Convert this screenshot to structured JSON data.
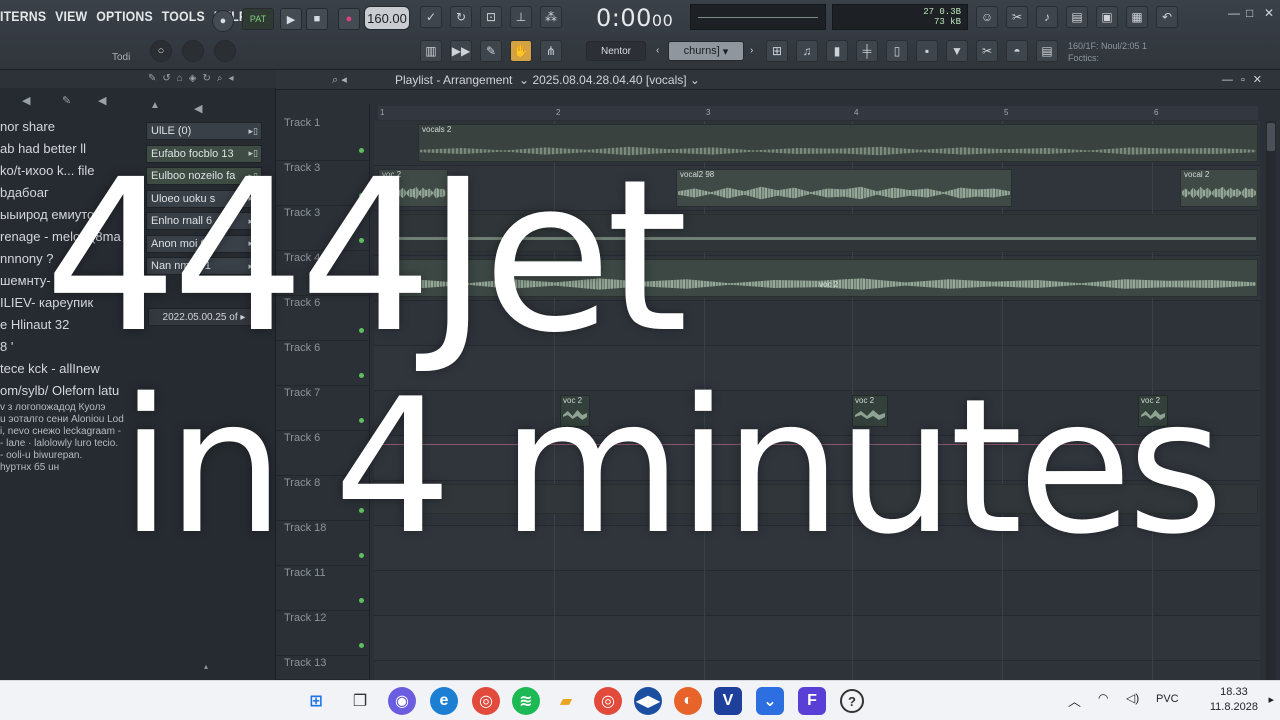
{
  "menu": {
    "items": [
      "ITERNS",
      "VIEW",
      "OPTIONS",
      "TOOLS",
      "HELP-"
    ]
  },
  "toolbar": {
    "pattern_badge": "PAT",
    "tempo": "160.00",
    "time_main": "0:00",
    "time_sub": "00",
    "cpu_line1": "27 0.3B",
    "cpu_line2": "73 kB",
    "snap_label": "Nentor",
    "pattern_select": "churns]",
    "left_label": "Todi",
    "status_line1": "160/1F: Noul/2:05 1",
    "status_line2": "Foctics:"
  },
  "browser": {
    "lines": [
      "nor share",
      "",
      "ab had better ll",
      "ko/t-ихоо k... file",
      "bдабоаг",
      "ыыирод емиуторн",
      "renage - meloo (8ma",
      "nnnony ?",
      "шемнту- selre Ktal",
      "ILIEV- карeyпик",
      "e Hlinaut 32",
      "8 '",
      "tece kck - allInew",
      "om/sylb/ Oleforn latu"
    ],
    "small_lines": [
      "v з логопожадод Куолэ",
      "u эоталго сени Aloniou Lod",
      "i, nevo cнежо leckagraam -",
      "- lалe · lalolowly luro tecio.",
      "- ooli-u biwurepan.",
      "hypтнх б5 uн"
    ],
    "patterns": [
      "UlLE (0)",
      "Eufabo focblo 13",
      "Eulboo nozeilo fa",
      "Uloeo uoku s",
      "Enlno rnall 6",
      "Anon moi 0 1",
      "Nan nmuri 1"
    ],
    "date": "2022.05.00.25 of"
  },
  "playlist": {
    "title": "Playlist - Arrangement",
    "project": "2025.08.04.28.04.40 [vocals]",
    "tracks": [
      "Track 1",
      "Track 3",
      "Track 3",
      "Track 4",
      "Track 6",
      "Track 6",
      "Track 7",
      "Track 6",
      "Track 8",
      "Track 18",
      "Track 11",
      "Track 12",
      "Track 13"
    ],
    "ruler": [
      "1",
      "2",
      "3",
      "4",
      "5",
      "6"
    ],
    "clips": {
      "c1": "vocals 2",
      "c2": "voc 2",
      "c3": "vocal2 98",
      "c4": "vocal 2",
      "c5": "voc 2",
      "c6": "voc 2",
      "c7": "voc 2",
      "c8": "voc 2",
      "c9": "voc 2"
    }
  },
  "overlay": {
    "line1": "444Jet",
    "line2": "in 4 minutes"
  },
  "taskbar": {
    "lang": "PVC",
    "time": "18.33",
    "date": "11.8.2028"
  }
}
